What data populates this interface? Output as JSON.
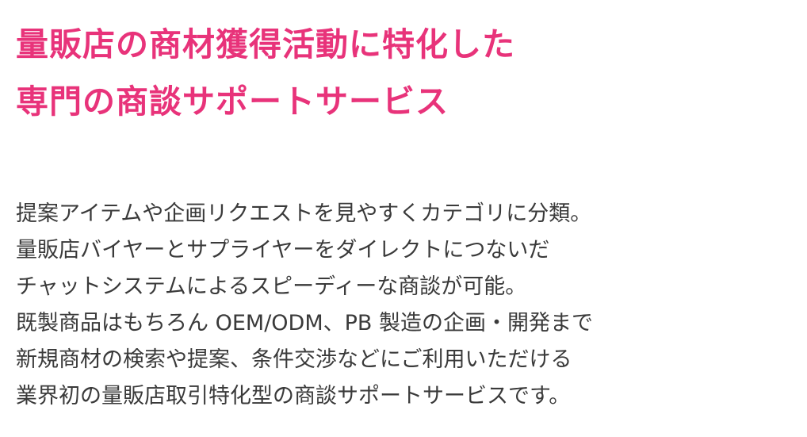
{
  "headline": {
    "lines": [
      "量販店の商材獲得活動に特化した",
      "専門の商談サポートサービス"
    ]
  },
  "description": {
    "lines": [
      "提案アイテムや企画リクエストを見やすくカテゴリに分類。",
      "量販店バイヤーとサプライヤーをダイレクトにつないだ",
      "チャットシステムによるスピーディーな商談が可能。",
      "既製商品はもちろん OEM/ODM、PB 製造の企画・開発まで",
      "新規商材の検索や提案、条件交渉などにご利用いただける",
      "業界初の量販店取引特化型の商談サポートサービスです。"
    ]
  },
  "colors": {
    "headline": "#e8337a",
    "body": "#3a3a3a",
    "background": "#ffffff"
  }
}
